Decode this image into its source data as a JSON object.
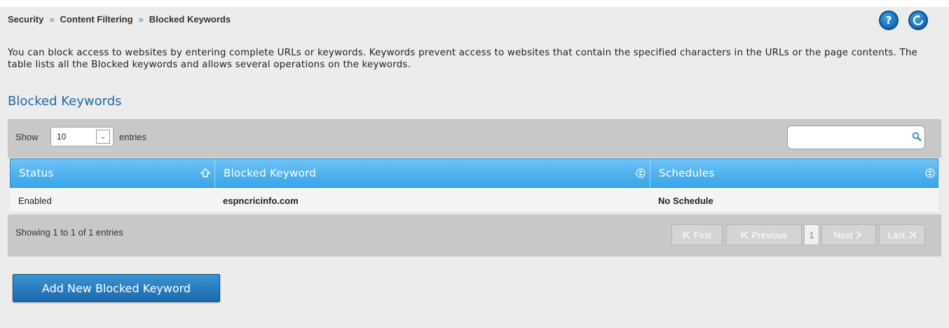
{
  "breadcrumb": {
    "items": [
      "Security",
      "Content Filtering",
      "Blocked Keywords"
    ],
    "separator": "»"
  },
  "header_buttons": {
    "help_label": "?",
    "refresh_icon": "refresh-icon"
  },
  "description": "You can block access to websites by entering complete URLs or keywords. Keywords prevent access to websites that contain the specified characters in the URLs or the page contents. The table lists all the Blocked keywords and allows several operations on the keywords.",
  "section_title": "Blocked Keywords",
  "toolbar": {
    "show_label": "Show",
    "entries_value": "10",
    "entries_label": "entries",
    "search_value": ""
  },
  "table": {
    "columns": [
      "Status",
      "Blocked Keyword",
      "Schedules"
    ],
    "rows": [
      {
        "status": "Enabled",
        "keyword": "espncricinfo.com",
        "schedule": "No Schedule"
      }
    ]
  },
  "footer": {
    "info": "Showing 1 to 1 of 1 entries",
    "first": "First",
    "previous": "Previous",
    "page": "1",
    "next": "Next",
    "last": "Last"
  },
  "add_button_label": "Add New Blocked Keyword",
  "colors": {
    "accent": "#1f6aa5",
    "header_blue": "#3aa4e8",
    "panel_bg": "#ececec",
    "toolbar_bg": "#c8c8c8"
  }
}
